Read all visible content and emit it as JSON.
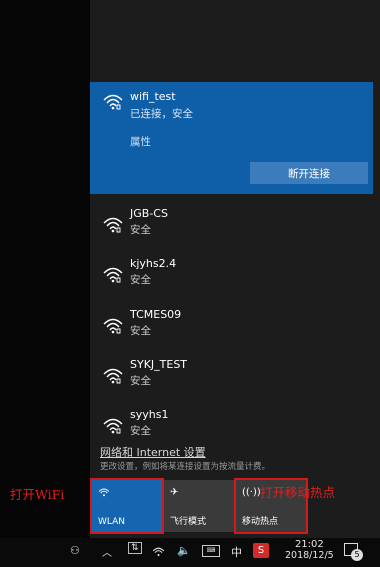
{
  "connected_network": {
    "ssid": "wifi_test",
    "status": "已连接，安全",
    "properties_label": "属性",
    "disconnect_label": "断开连接"
  },
  "networks": [
    {
      "ssid": "JGB-CS",
      "status": "安全"
    },
    {
      "ssid": "kjyhs2.4",
      "status": "安全"
    },
    {
      "ssid": "TCMES09",
      "status": "安全"
    },
    {
      "ssid": "SYKJ_TEST",
      "status": "安全"
    },
    {
      "ssid": "syyhs1",
      "status": "安全"
    }
  ],
  "settings": {
    "link_label": "网络和 Internet 设置",
    "description": "更改设置，例如将某连接设置为按流量计费。"
  },
  "quick_actions": [
    {
      "label": "WLAN",
      "icon": "wifi-icon",
      "active": true
    },
    {
      "label": "飞行模式",
      "icon": "airplane-icon",
      "active": false
    },
    {
      "label": "移动热点",
      "icon": "hotspot-icon",
      "active": false
    }
  ],
  "annotations": {
    "left": "打开WiFi",
    "right": "打开移动热点"
  },
  "taskbar": {
    "ime_label": "中",
    "time": "21:02",
    "date": "2018/12/5",
    "notification_count": "5"
  },
  "colors": {
    "accent": "#0f5ea8",
    "annotation_red": "#d31a1a"
  }
}
